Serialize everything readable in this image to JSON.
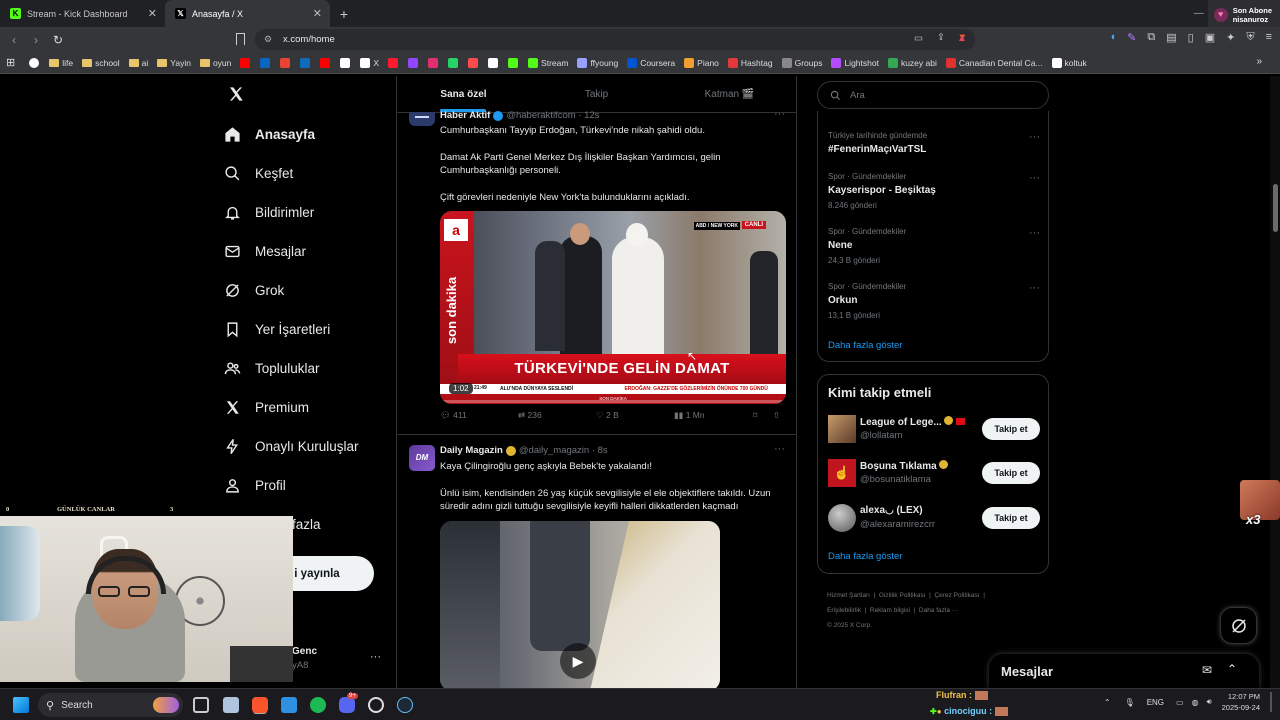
{
  "browser": {
    "tabs": [
      {
        "title": "Stream - Kick Dashboard",
        "active": false
      },
      {
        "title": "Anasayfa / X",
        "active": true
      }
    ],
    "new_tab": "+",
    "url": "x.com/home",
    "twitch_alert": {
      "line1": "Son Abone",
      "line2": "nisanuroz"
    },
    "bookmarks": [
      {
        "label": "life",
        "icon": "folder-icon",
        "color": "#e8c46a"
      },
      {
        "label": "school",
        "icon": "folder-icon",
        "color": "#e8c46a"
      },
      {
        "label": "ai",
        "icon": "folder-icon",
        "color": "#e8c46a"
      },
      {
        "label": "Yayin",
        "icon": "folder-icon",
        "color": "#e8c46a"
      },
      {
        "label": "oyun",
        "icon": "folder-icon",
        "color": "#e8c46a"
      },
      {
        "label": "",
        "icon": "youtube-icon",
        "color": "#ff0000"
      },
      {
        "label": "",
        "icon": "linkedin-icon",
        "color": "#0a66c2"
      },
      {
        "label": "",
        "icon": "gmail-icon",
        "color": "#ea4335"
      },
      {
        "label": "",
        "icon": "outlook-icon",
        "color": "#0f6cbd"
      },
      {
        "label": "",
        "icon": "youtube-icon",
        "color": "#ff0000"
      },
      {
        "label": "",
        "icon": "chrome-icon",
        "color": "#ffffff"
      },
      {
        "label": "X",
        "icon": "x-icon",
        "color": "#ffffff"
      },
      {
        "label": "",
        "icon": "opera-icon",
        "color": "#ff1b2d"
      },
      {
        "label": "",
        "icon": "twitch-icon",
        "color": "#9146ff"
      },
      {
        "label": "",
        "icon": "instagram-icon",
        "color": "#e1306c"
      },
      {
        "label": "",
        "icon": "whatsapp-icon",
        "color": "#25d366"
      },
      {
        "label": "",
        "icon": "tumblr-icon",
        "color": "#ff4b4b"
      },
      {
        "label": "",
        "icon": "amazon-icon",
        "color": "#ffffff"
      },
      {
        "label": "",
        "icon": "kick-icon",
        "color": "#53fc18"
      },
      {
        "label": "Stream",
        "icon": "kick-icon",
        "color": "#53fc18"
      },
      {
        "label": "ffyoung",
        "icon": "link-icon",
        "color": "#9aa0ff"
      },
      {
        "label": "Coursera",
        "icon": "coursera-icon",
        "color": "#0056d2"
      },
      {
        "label": "Piano",
        "icon": "piano-icon",
        "color": "#f0a030"
      },
      {
        "label": "Hashtag",
        "icon": "hashtag-icon",
        "color": "#e23a3a"
      },
      {
        "label": "Groups",
        "icon": "groups-icon",
        "color": "#888888"
      },
      {
        "label": "Lightshot",
        "icon": "lightshot-icon",
        "color": "#b44dff"
      },
      {
        "label": "kuzey abi",
        "icon": "drive-icon",
        "color": "#34a853"
      },
      {
        "label": "Canadian Dental Ca...",
        "icon": "maple-icon",
        "color": "#e03030"
      },
      {
        "label": "koltuk",
        "icon": "page-icon",
        "color": "#ffffff"
      }
    ]
  },
  "nav": {
    "items": [
      {
        "label": "Anasayfa",
        "icon": "home-icon",
        "active": true
      },
      {
        "label": "Keşfet",
        "icon": "search-icon"
      },
      {
        "label": "Bildirimler",
        "icon": "bell-icon"
      },
      {
        "label": "Mesajlar",
        "icon": "mail-icon"
      },
      {
        "label": "Grok",
        "icon": "grok-icon"
      },
      {
        "label": "Yer İşaretleri",
        "icon": "bookmark-icon"
      },
      {
        "label": "Topluluklar",
        "icon": "communities-icon"
      },
      {
        "label": "Premium",
        "icon": "x-icon"
      },
      {
        "label": "Onaylı Kuruluşlar",
        "icon": "bolt-icon"
      },
      {
        "label": "Profil",
        "icon": "person-icon"
      },
      {
        "label": "fazla",
        "icon": "more-icon"
      }
    ],
    "post_button": "i yayınla",
    "account_name": "Genc",
    "account_handle": "yA8",
    "account_more": "···"
  },
  "feed": {
    "tabs": [
      "Sana özel",
      "Takip",
      "Katman 🎬"
    ],
    "tweets": [
      {
        "name": "Haber Aktif",
        "handle": "@haberaktifcom · 12s",
        "paragraphs": [
          "Cumhurbaşkanı Tayyip Erdoğan, Türkevi'nde nikah şahidi oldu.",
          "Damat Ak Parti Genel Merkez Dış İlişkiler Başkan Yardımcısı, gelin Cumhurbaşkanlığı personeli.",
          "Çift görevleri nedeniyle New York'ta bulunduklarını açıkladı."
        ],
        "video": {
          "banner": "TÜRKEVİ'NDE GELİN DAMAT",
          "side": "son dakika",
          "live": "CANLI",
          "location": "ABD / NEW YORK",
          "ticker": "ALU'NDA DÜNYAYA SESLENDİ",
          "ticker2": "ERDOĞAN: GAZZE'DE GÖZLERİMİZİN ÖNÜNDE 700 GÜNDÜ",
          "time": "1:02",
          "clock": "21:49",
          "bottom": "SON DAKİKA"
        },
        "stats": {
          "replies": "411",
          "reposts": "236",
          "likes": "2 B",
          "views": "1 Mn"
        }
      },
      {
        "name": "Daily Magazin",
        "handle": "@daily_magazin · 8s",
        "avatar_text": "DM",
        "paragraphs": [
          "Kaya Çilingiroğlu genç aşkıyla Bebek'te yakalandı!",
          "Ünlü isim, kendisinden 26 yaş küçük sevgilisiyle el ele objektiflere takıldı. Uzun süredir adını gizli tuttuğu sevgilisiyle keyifli halleri dikkatlerden kaçmadı"
        ]
      }
    ]
  },
  "right": {
    "search_placeholder": "Ara",
    "trends": [
      {
        "category": "Türkiye tarihinde gündemde",
        "title": "#FenerinMaçıVarTSL",
        "count": ""
      },
      {
        "category": "Spor · Gündemdekiler",
        "title": "Kayserispor - Beşiktaş",
        "count": "8.246 gönderi"
      },
      {
        "category": "Spor · Gündemdekiler",
        "title": "Nene",
        "count": "24,3 B gönderi"
      },
      {
        "category": "Spor · Gündemdekiler",
        "title": "Orkun",
        "count": "13,1 B gönderi"
      }
    ],
    "trends_more": "Daha fazla göster",
    "who_to_follow": {
      "title": "Kimi takip etmeli",
      "users": [
        {
          "name": "League of Lege...",
          "handle": "@lollatam",
          "button": "Takip et",
          "color": "#8a5a3a"
        },
        {
          "name": "Boşuna Tıklama",
          "handle": "@bosunatiklama",
          "button": "Takip et",
          "color": "#c0141e"
        },
        {
          "name": "alexa◡ (LEX)",
          "handle": "@alexaramirezcrr",
          "button": "Takip et",
          "color": "#777777"
        }
      ],
      "more": "Daha fazla göster"
    },
    "footer": {
      "links": [
        "Hizmet Şartları",
        "Gizlilik Politikası",
        "Çerez Politikası",
        "Erişilebilirlik",
        "Reklam bilgisi",
        "Daha fazla ···"
      ],
      "copyright": "© 2025 X Corp."
    },
    "messages_label": "Mesajlar"
  },
  "stream_overlay": {
    "left": "0",
    "title": "GÜNLÜK CANLAR",
    "right": "3",
    "chat": [
      {
        "user": "Flufran :",
        "color": "#f0c040"
      },
      {
        "user": "cinociguu :",
        "color": "#6fd0ff"
      }
    ],
    "emote_count": "x3"
  },
  "taskbar": {
    "search": "Search",
    "lang": "ENG",
    "time": "12:07 PM",
    "date": "2025-09-24",
    "discord_badge": "9+"
  }
}
